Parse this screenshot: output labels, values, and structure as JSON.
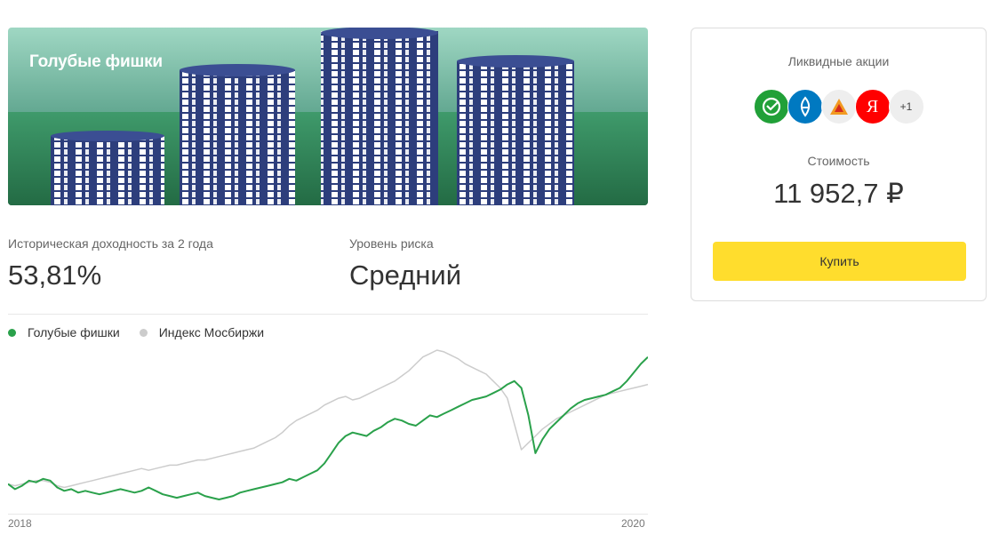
{
  "banner": {
    "title": "Голубые фишки"
  },
  "metrics": {
    "yield_label": "Историческая доходность за 2 года",
    "yield_value": "53,81%",
    "risk_label": "Уровень риска",
    "risk_value": "Средний"
  },
  "legend": [
    {
      "label": "Голубые фишки",
      "color": "#2aa14b"
    },
    {
      "label": "Индекс Мосбиржи",
      "color": "#cccccc"
    }
  ],
  "chart_data": {
    "type": "line",
    "x_labels": [
      "2018",
      "2020"
    ],
    "series": [
      {
        "name": "Голубые фишки",
        "color": "#2aa14b",
        "values": [
          100,
          97,
          99,
          102,
          101,
          103,
          102,
          98,
          96,
          97,
          95,
          96,
          95,
          94,
          95,
          96,
          97,
          96,
          95,
          96,
          98,
          96,
          94,
          93,
          92,
          93,
          94,
          95,
          93,
          92,
          91,
          92,
          93,
          95,
          96,
          97,
          98,
          99,
          100,
          101,
          103,
          102,
          104,
          106,
          108,
          112,
          118,
          124,
          128,
          130,
          129,
          128,
          131,
          133,
          136,
          138,
          137,
          135,
          134,
          137,
          140,
          139,
          141,
          143,
          145,
          147,
          149,
          150,
          151,
          153,
          155,
          158,
          160,
          156,
          140,
          118,
          126,
          132,
          136,
          140,
          144,
          147,
          149,
          150,
          151,
          152,
          154,
          156,
          160,
          165,
          170,
          174
        ]
      },
      {
        "name": "Индекс Мосбиржи",
        "color": "#cccccc",
        "values": [
          100,
          99,
          100,
          101,
          102,
          102,
          101,
          99,
          98,
          99,
          100,
          101,
          102,
          103,
          104,
          105,
          106,
          107,
          108,
          109,
          108,
          109,
          110,
          111,
          111,
          112,
          113,
          114,
          114,
          115,
          116,
          117,
          118,
          119,
          120,
          121,
          123,
          125,
          127,
          130,
          134,
          137,
          139,
          141,
          143,
          146,
          148,
          150,
          151,
          149,
          150,
          152,
          154,
          156,
          158,
          160,
          163,
          166,
          170,
          174,
          176,
          178,
          177,
          175,
          173,
          170,
          168,
          166,
          164,
          160,
          156,
          150,
          135,
          120,
          124,
          128,
          132,
          135,
          138,
          140,
          142,
          144,
          146,
          148,
          150,
          152,
          153,
          154,
          155,
          156,
          157,
          158
        ]
      }
    ]
  },
  "card": {
    "liquid_label": "Ликвидные акции",
    "logos": [
      {
        "icon": "sberbank-icon",
        "color": "#21a038"
      },
      {
        "icon": "gazprom-icon",
        "color": "#0079c1"
      },
      {
        "icon": "lukoil-icon",
        "color": "#eeeeee"
      },
      {
        "icon": "yandex-icon",
        "color": "#ff0000",
        "text": "Я"
      },
      {
        "icon": "more-icon",
        "color": "#eeeeee",
        "text": "+1"
      }
    ],
    "cost_label": "Стоимость",
    "cost_value": "11 952,7 ₽",
    "buy_label": "Купить"
  }
}
